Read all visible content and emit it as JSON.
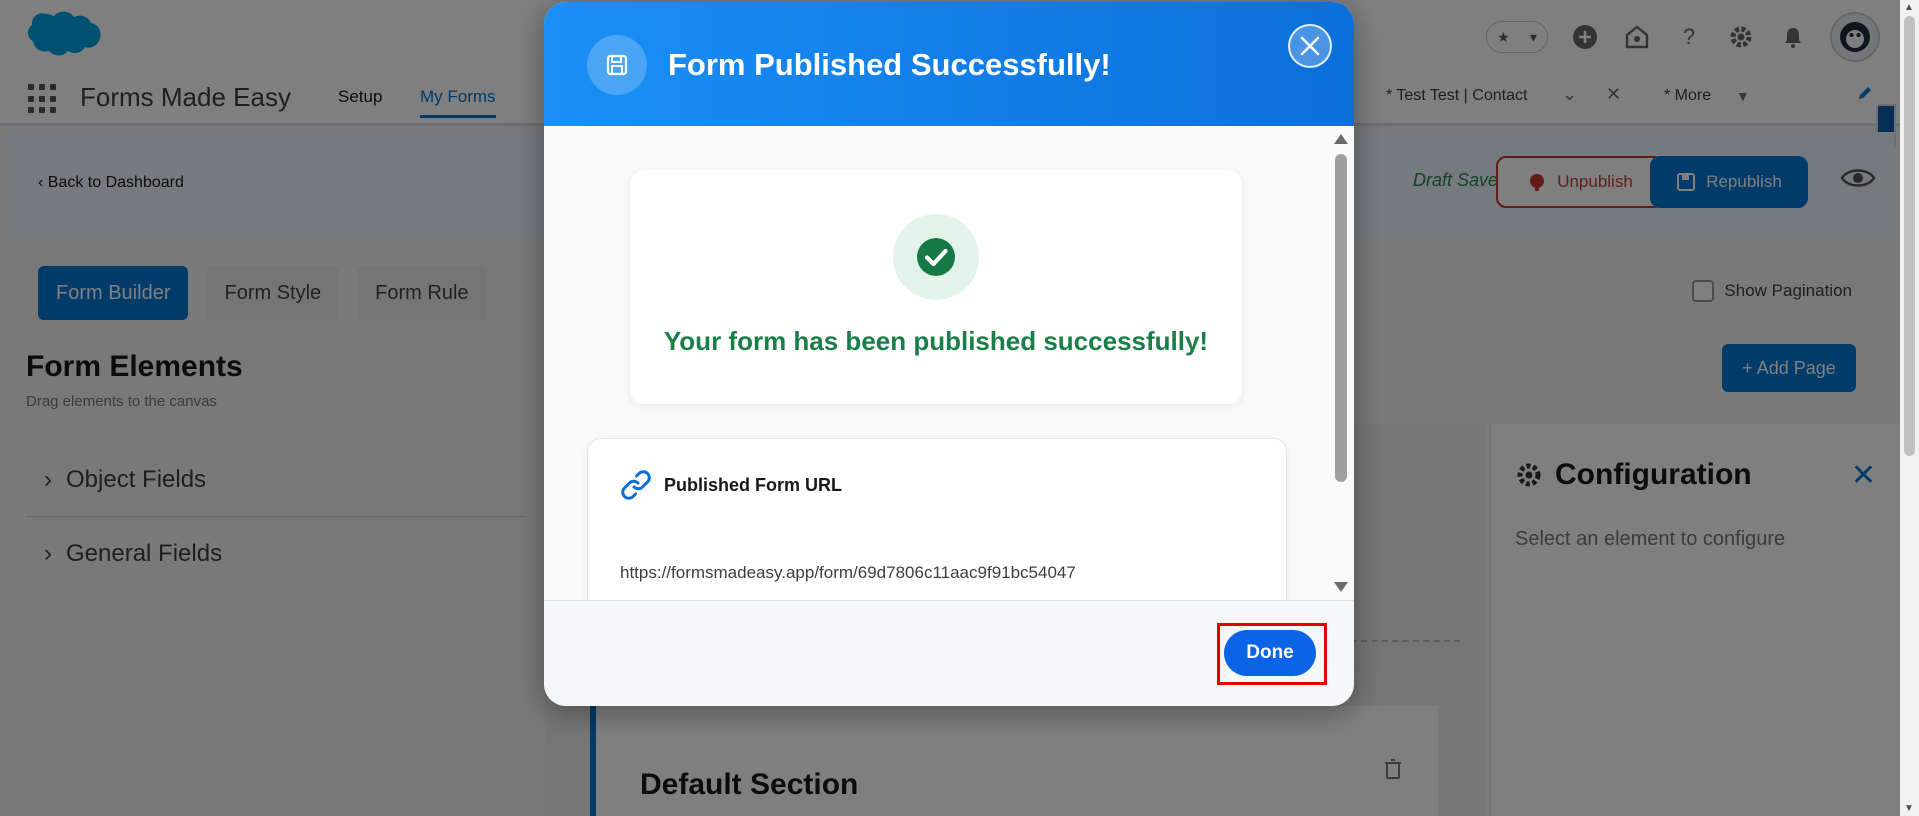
{
  "colors": {
    "brand": "#0176d3",
    "modal_header": "#0b6fd9",
    "success_green": "#1a7f47",
    "highlight_red": "#e40000",
    "done_button": "#0b63e5"
  },
  "header": {
    "logo": "salesforce-cloud-logo",
    "icons": [
      "star-icon",
      "chevron-down-icon",
      "add-icon",
      "trailhead-icon",
      "help-icon",
      "gear-icon",
      "bell-icon"
    ],
    "fav_star": "★",
    "fav_caret": "▾",
    "plus": "+",
    "help": "?"
  },
  "nav": {
    "app_name": "Forms Made Easy",
    "tabs": [
      {
        "label": "Setup"
      },
      {
        "label": "My Forms"
      }
    ],
    "right_tabs": [
      {
        "label": "* Test Test | Contact"
      },
      {
        "label": "* More"
      }
    ],
    "chevron": "⌄",
    "close": "✕",
    "more_caret": "▼"
  },
  "page_header": {
    "back_label": "Back to Dashboard",
    "back_chevron": "‹",
    "draft_status": "Draft Saved",
    "unpublish_label": "Unpublish",
    "republish_label": "Republish"
  },
  "builder": {
    "tabs": [
      {
        "label": "Form Builder",
        "active": true
      },
      {
        "label": "Form Style",
        "active": false
      },
      {
        "label": "Form Rule",
        "active": false
      }
    ],
    "show_pagination_label": "Show Pagination",
    "add_page_label": "+ Add Page"
  },
  "elements": {
    "title": "Form Elements",
    "subtitle": "Drag elements to the canvas",
    "groups": [
      {
        "label": "Object Fields"
      },
      {
        "label": "General Fields"
      }
    ],
    "chevron": "›"
  },
  "canvas": {
    "section_title": "Default Section"
  },
  "config": {
    "title": "Configuration",
    "subtitle": "Select an element to configure",
    "close": "✕"
  },
  "modal": {
    "title": "Form Published Successfully!",
    "success_message": "Your form has been published successfully!",
    "url_label": "Published Form URL",
    "url_value": "https://formsmadeasy.app/form/69d7806c11aac9f91bc54047",
    "done_label": "Done"
  }
}
